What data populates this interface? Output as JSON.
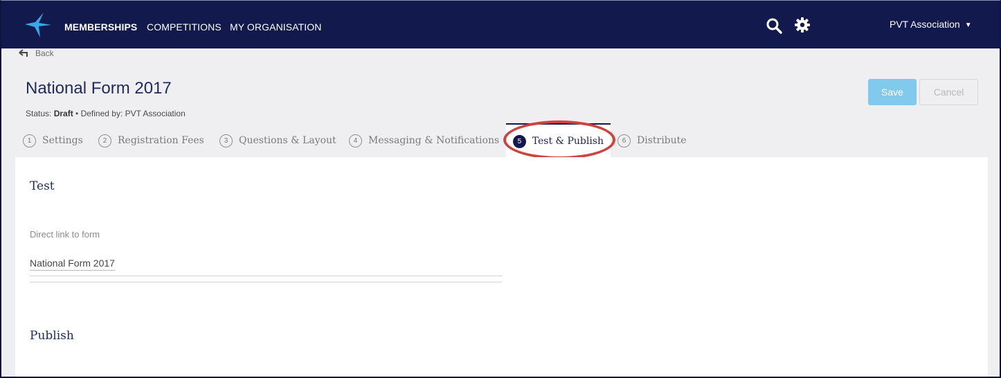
{
  "nav": {
    "items": [
      {
        "label": "MEMBERSHIPS",
        "active": true
      },
      {
        "label": "COMPETITIONS",
        "active": false
      },
      {
        "label": "MY ORGANISATION",
        "active": false
      }
    ],
    "org_label": "PVT Association",
    "icons": [
      "search-icon",
      "gear-icon",
      "caret-down-icon"
    ]
  },
  "page": {
    "back_label": "Back",
    "title": "National Form 2017",
    "status_prefix": "Status: ",
    "status_value": "Draft",
    "defined_by": " • Defined by: PVT Association"
  },
  "actions": {
    "save_label": "Save",
    "cancel_label": "Cancel"
  },
  "tabs": [
    {
      "num": "1",
      "label": "Settings"
    },
    {
      "num": "2",
      "label": "Registration Fees"
    },
    {
      "num": "3",
      "label": "Questions & Layout"
    },
    {
      "num": "4",
      "label": "Messaging & Notifications"
    },
    {
      "num": "5",
      "label": "Test & Publish",
      "active": true
    },
    {
      "num": "6",
      "label": "Distribute"
    }
  ],
  "test_section": {
    "title": "Test",
    "link_label": "Direct link to form",
    "link_value": "National Form 2017"
  },
  "publish_section": {
    "title": "Publish"
  },
  "colors": {
    "header": "#12194d",
    "accent": "#82c9ee",
    "annotation": "#d0423c"
  }
}
